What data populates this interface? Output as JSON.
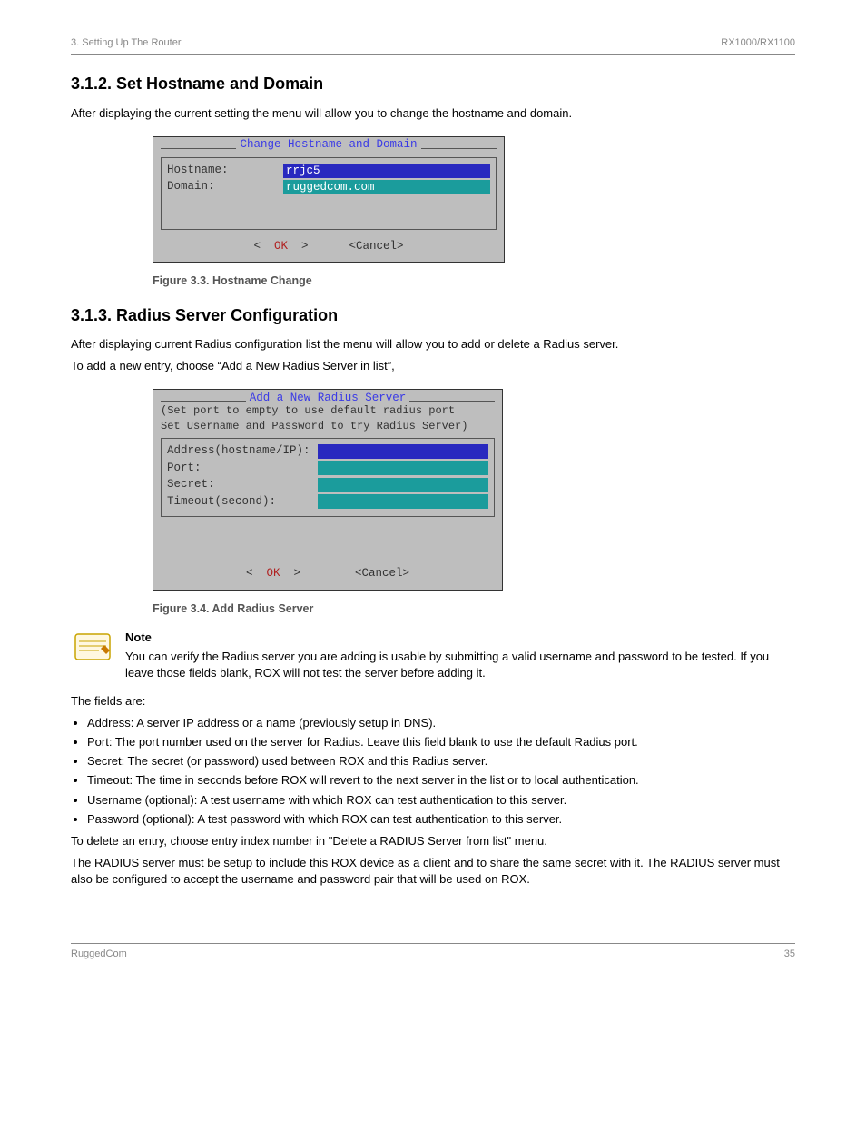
{
  "header": {
    "left": "3. Setting Up The Router",
    "right": "RX1000/RX1100"
  },
  "footer": {
    "left": "RuggedCom",
    "right": "35"
  },
  "section": {
    "title": "3.1.2. Set Hostname and Domain",
    "instruction": "After displaying the current setting the menu will allow you to change the hostname and domain."
  },
  "dialog1": {
    "title": "Change Hostname and Domain",
    "fields": {
      "hostname": {
        "label": "Hostname:",
        "value": "rrjc5"
      },
      "domain": {
        "label": "Domain:",
        "value": "ruggedcom.com"
      }
    },
    "ok": "OK",
    "cancel": "<Cancel>",
    "caption": "Figure 3.3. Hostname Change"
  },
  "radius": {
    "title": "3.1.3. Radius Server Configuration",
    "p1": "After displaying current Radius configuration list the menu will allow you to add or delete a Radius server.",
    "p2": "To add a new entry, choose “Add a New Radius Server in list”,"
  },
  "dialog2": {
    "title": "Add a New Radius Server",
    "desc1": "(Set port to empty to use default radius port",
    "desc2": "Set Username and Password to try Radius Server)",
    "fields": {
      "address": {
        "label": "Address(hostname/IP):",
        "value": ""
      },
      "port": {
        "label": "Port:",
        "value": ""
      },
      "secret": {
        "label": "Secret:",
        "value": ""
      },
      "timeout": {
        "label": "Timeout(second):",
        "value": ""
      }
    },
    "ok": "OK",
    "cancel": "<Cancel>",
    "caption": "Figure 3.4. Add Radius Server"
  },
  "note": {
    "heading": "Note",
    "text": "You can verify the Radius server you are adding is usable by submitting a valid username and password to be tested. If you leave those fields blank, ROX will not test the server before adding it."
  },
  "radius_desc": {
    "intro": "The fields are:",
    "items": [
      "Address: A server IP address or a name (previously setup in DNS).",
      "Port: The port number used on the server for Radius. Leave this field blank to use the default Radius port.",
      "Secret: The secret (or password) used between ROX and this Radius server.",
      "Timeout: The time in seconds before ROX will revert to the next server in the list or to local authentication.",
      "Username (optional): A test username with which ROX can test authentication to this server.",
      "Password (optional): A test password with which ROX can test authentication to this server."
    ],
    "p2": "To delete an entry, choose entry index number in \"Delete a RADIUS Server from list\" menu.",
    "p3": "The RADIUS server must be setup to include this ROX device as a client and to share the same secret with it. The RADIUS server must also be configured to accept the username and password pair that will be used on ROX."
  }
}
